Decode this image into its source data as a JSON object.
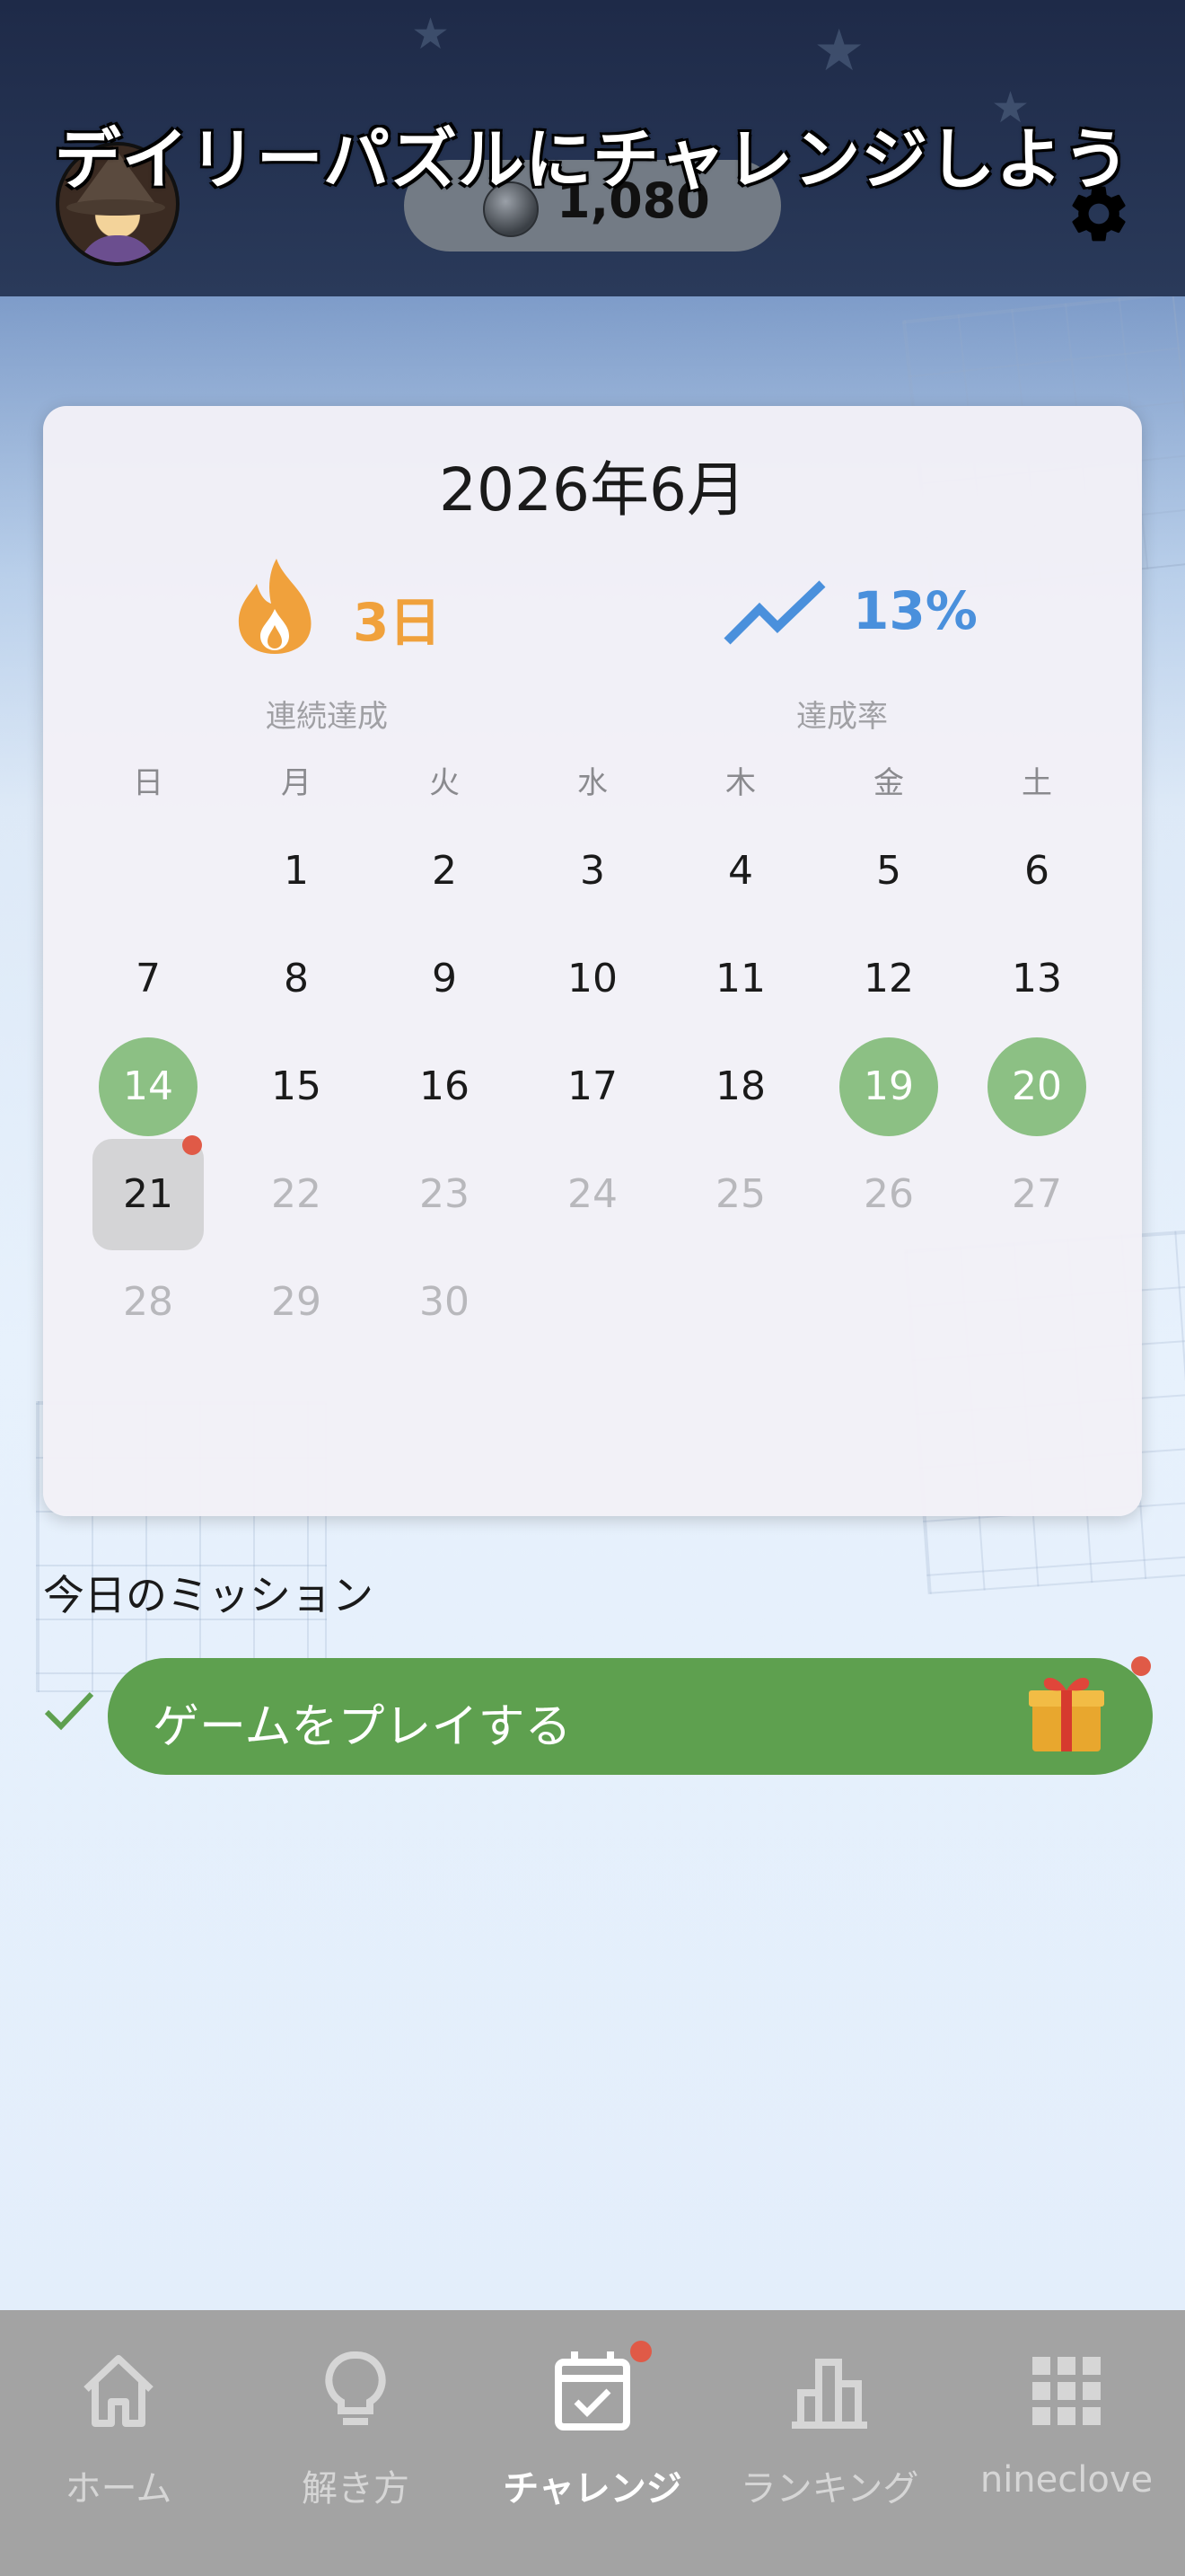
{
  "header": {
    "title": "デイリーパズルにチャレンジしよう",
    "coins": "1,080",
    "coin_icon": "coin-icon",
    "avatar_icon": "witch-avatar-icon",
    "settings_icon": "gear-icon"
  },
  "calendar": {
    "month_label": "2026年6月",
    "streak_value": "3日",
    "streak_label": "連続達成",
    "rate_value": "13%",
    "rate_label": "達成率",
    "weekdays": [
      "日",
      "月",
      "火",
      "水",
      "木",
      "金",
      "土"
    ],
    "days": [
      "1",
      "2",
      "3",
      "4",
      "5",
      "6",
      "7",
      "8",
      "9",
      "10",
      "11",
      "12",
      "13",
      "14",
      "15",
      "16",
      "17",
      "18",
      "19",
      "20",
      "21",
      "22",
      "23",
      "24",
      "25",
      "26",
      "27",
      "28",
      "29",
      "30"
    ],
    "first_weekday_index": 1,
    "completed_days": [
      14,
      19,
      20
    ],
    "today": 21,
    "colors": {
      "completed": "#8cc084",
      "streak": "#f0a13c",
      "rate": "#4a90dc"
    }
  },
  "mission": {
    "title": "今日のミッション",
    "button_label": "ゲームをプレイする",
    "completed": true,
    "reward_icon": "gift-icon",
    "button_color": "#5ea04f"
  },
  "tabs": [
    {
      "label": "ホーム",
      "icon": "home-icon",
      "active": false
    },
    {
      "label": "解き方",
      "icon": "lightbulb-icon",
      "active": false
    },
    {
      "label": "チャレンジ",
      "icon": "calendar-check-icon",
      "active": true
    },
    {
      "label": "ランキング",
      "icon": "bar-chart-icon",
      "active": false
    },
    {
      "label": "nineclove",
      "icon": "grid-icon",
      "active": false
    }
  ]
}
